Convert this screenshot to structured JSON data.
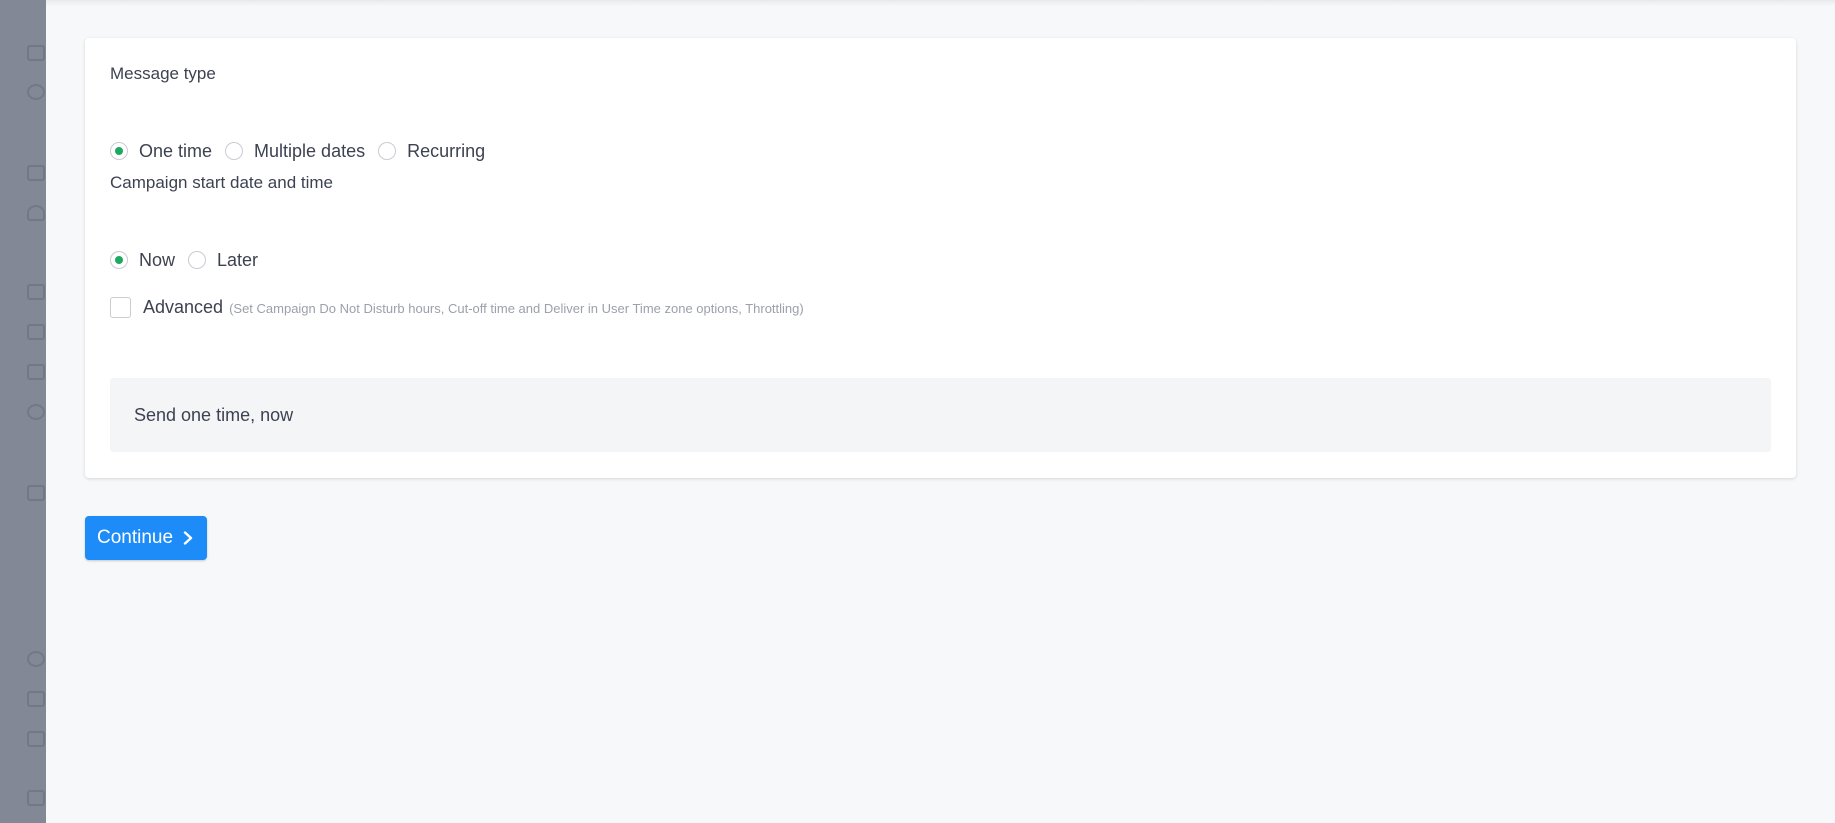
{
  "sidebar": {
    "icons": [
      "users-icon",
      "chart-pie-icon",
      "bar-chart-icon",
      "person-icon",
      "chat-icon",
      "inbox-icon",
      "mail-icon",
      "refresh-icon",
      "calendar-icon",
      "gear-icon",
      "book-icon",
      "warning-icon",
      "apps-icon"
    ]
  },
  "schedule": {
    "message_type": {
      "label": "Message type",
      "options": [
        {
          "label": "One time",
          "checked": true
        },
        {
          "label": "Multiple dates",
          "checked": false
        },
        {
          "label": "Recurring",
          "checked": false
        }
      ]
    },
    "start": {
      "label": "Campaign start date and time",
      "options": [
        {
          "label": "Now",
          "checked": true
        },
        {
          "label": "Later",
          "checked": false
        }
      ]
    },
    "advanced": {
      "label": "Advanced",
      "hint": "(Set Campaign Do Not Disturb hours, Cut-off time and Deliver in User Time zone options, Throttling)",
      "checked": false
    },
    "summary": "Send one time, now"
  },
  "actions": {
    "continue_label": "Continue"
  },
  "colors": {
    "accent": "#1d8cf8",
    "radio_selected": "#1fa862",
    "text": "#3d4252",
    "hint": "#9ba0ab"
  }
}
